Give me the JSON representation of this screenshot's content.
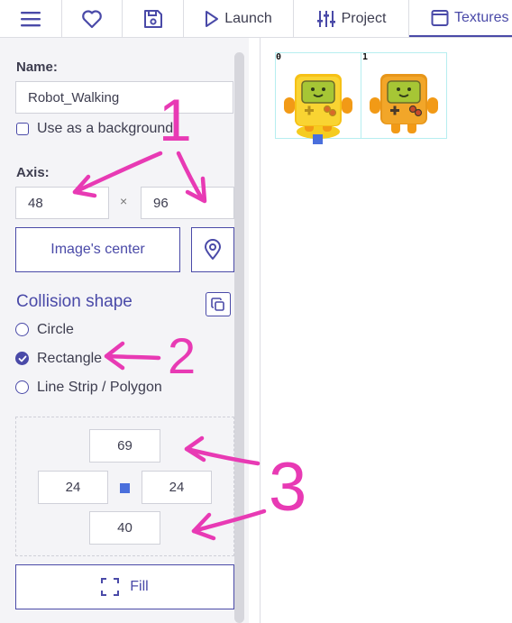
{
  "toolbar": {
    "menu_icon": "hamburger-menu-icon",
    "favorite_icon": "heart-icon",
    "save_icon": "floppy-disk-icon",
    "launch_label": "Launch",
    "project_label": "Project",
    "textures_label": "Textures"
  },
  "panel": {
    "name_label": "Name:",
    "name_value": "Robot_Walking",
    "background_checkbox_label": "Use as a background",
    "background_checked": false,
    "axis_label": "Axis:",
    "axis_x": "48",
    "axis_separator": "×",
    "axis_y": "96",
    "image_center_label": "Image's center",
    "collision_title": "Collision shape",
    "shapes": [
      {
        "label": "Circle",
        "checked": false
      },
      {
        "label": "Rectangle",
        "checked": true
      },
      {
        "label": "Line Strip / Polygon",
        "checked": false
      }
    ],
    "rect_top": "69",
    "rect_left": "24",
    "rect_right": "24",
    "rect_bottom": "40",
    "fill_label": "Fill"
  },
  "preview": {
    "frames": [
      {
        "index": "0"
      },
      {
        "index": "1"
      }
    ]
  },
  "annotations": {
    "labels": [
      "1",
      "2",
      "3"
    ],
    "color": "#e83ab4"
  },
  "colors": {
    "accent": "#4a4aa8",
    "annotation": "#e83ab4",
    "frame_outline": "#b6eef0"
  }
}
